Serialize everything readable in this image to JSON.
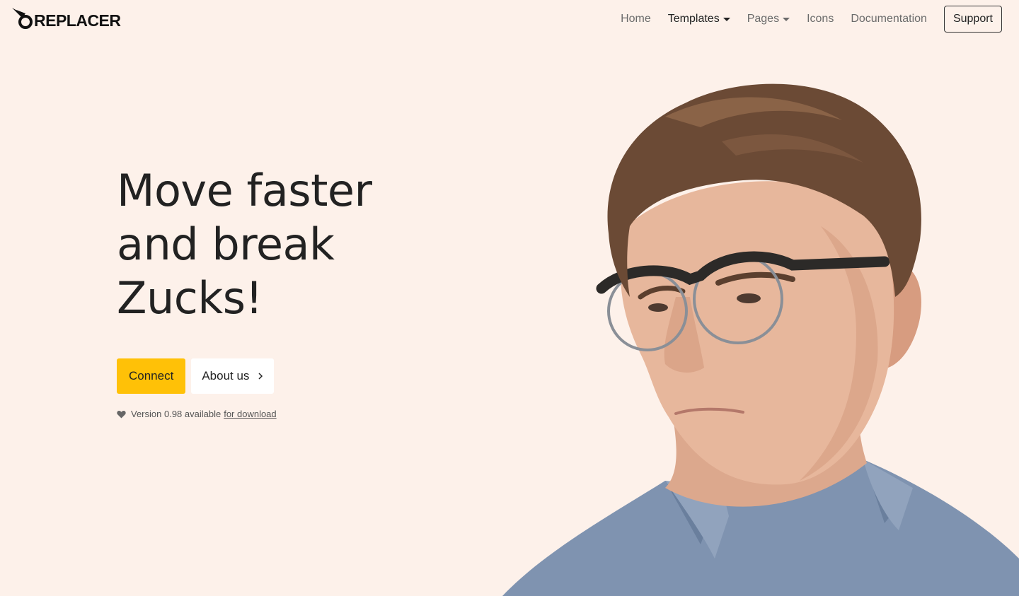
{
  "brand": {
    "name": "REPLACER",
    "icon": "bird-logo-icon"
  },
  "nav": {
    "items": [
      {
        "label": "Home",
        "dropdown": false,
        "active": false
      },
      {
        "label": "Templates",
        "dropdown": true,
        "active": true
      },
      {
        "label": "Pages",
        "dropdown": true,
        "active": false
      },
      {
        "label": "Icons",
        "dropdown": false,
        "active": false
      },
      {
        "label": "Documentation",
        "dropdown": false,
        "active": false
      }
    ],
    "support_label": "Support"
  },
  "hero": {
    "title_lines": [
      "Move faster",
      "and break",
      "Zucks!"
    ],
    "connect_label": "Connect",
    "about_label": "About us",
    "version_text": "Version 0.98 available",
    "download_link": "for download"
  },
  "colors": {
    "background": "#fdf1ea",
    "accent": "#ffc107",
    "text": "#222222"
  },
  "icons": {
    "about_chevron": "chevron-right-icon",
    "version_heart": "heart-icon"
  }
}
